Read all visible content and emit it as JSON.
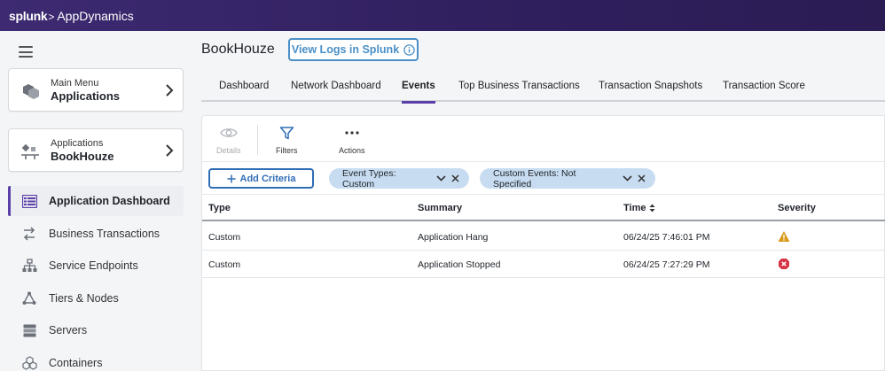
{
  "topbar": {
    "brand_splunk": "splunk",
    "brand_chevron": ">",
    "brand_app": "AppDynamics"
  },
  "sidebar": {
    "main_menu": {
      "small": "Main Menu",
      "big": "Applications"
    },
    "app_card": {
      "small": "Applications",
      "big": "BookHouze"
    },
    "items": [
      {
        "label": "Application Dashboard",
        "icon": "dashboard-icon",
        "active": true
      },
      {
        "label": "Business Transactions",
        "icon": "business-transactions-icon"
      },
      {
        "label": "Service Endpoints",
        "icon": "service-endpoints-icon"
      },
      {
        "label": "Tiers & Nodes",
        "icon": "tiers-nodes-icon"
      },
      {
        "label": "Servers",
        "icon": "servers-icon"
      },
      {
        "label": "Containers",
        "icon": "containers-icon"
      }
    ]
  },
  "header": {
    "app_title": "BookHouze",
    "logs_button": "View Logs in Splunk"
  },
  "tabs": [
    {
      "label": "Dashboard"
    },
    {
      "label": "Network Dashboard"
    },
    {
      "label": "Events",
      "active": true
    },
    {
      "label": "Top Business Transactions"
    },
    {
      "label": "Transaction Snapshots"
    },
    {
      "label": "Transaction Score"
    }
  ],
  "toolbar": {
    "details": "Details",
    "filters": "Filters",
    "actions": "Actions"
  },
  "criteria": {
    "add_label": "Add Criteria",
    "chips": [
      {
        "label": "Event Types: Custom"
      },
      {
        "label": "Custom Events: Not Specified"
      }
    ]
  },
  "table": {
    "columns": {
      "type": "Type",
      "summary": "Summary",
      "time": "Time",
      "severity": "Severity"
    },
    "rows": [
      {
        "type": "Custom",
        "summary": "Application Hang",
        "time": "06/24/25 7:46:01 PM",
        "severity": "warning"
      },
      {
        "type": "Custom",
        "summary": "Application Stopped",
        "time": "06/24/25 7:27:29 PM",
        "severity": "error"
      }
    ]
  },
  "colors": {
    "accent": "#5b3fa8",
    "link_blue": "#2f6db5",
    "chip_bg": "#c7dcf0",
    "warning": "#d99a1b",
    "error": "#d63344",
    "topbar": "#2f1f5d"
  }
}
